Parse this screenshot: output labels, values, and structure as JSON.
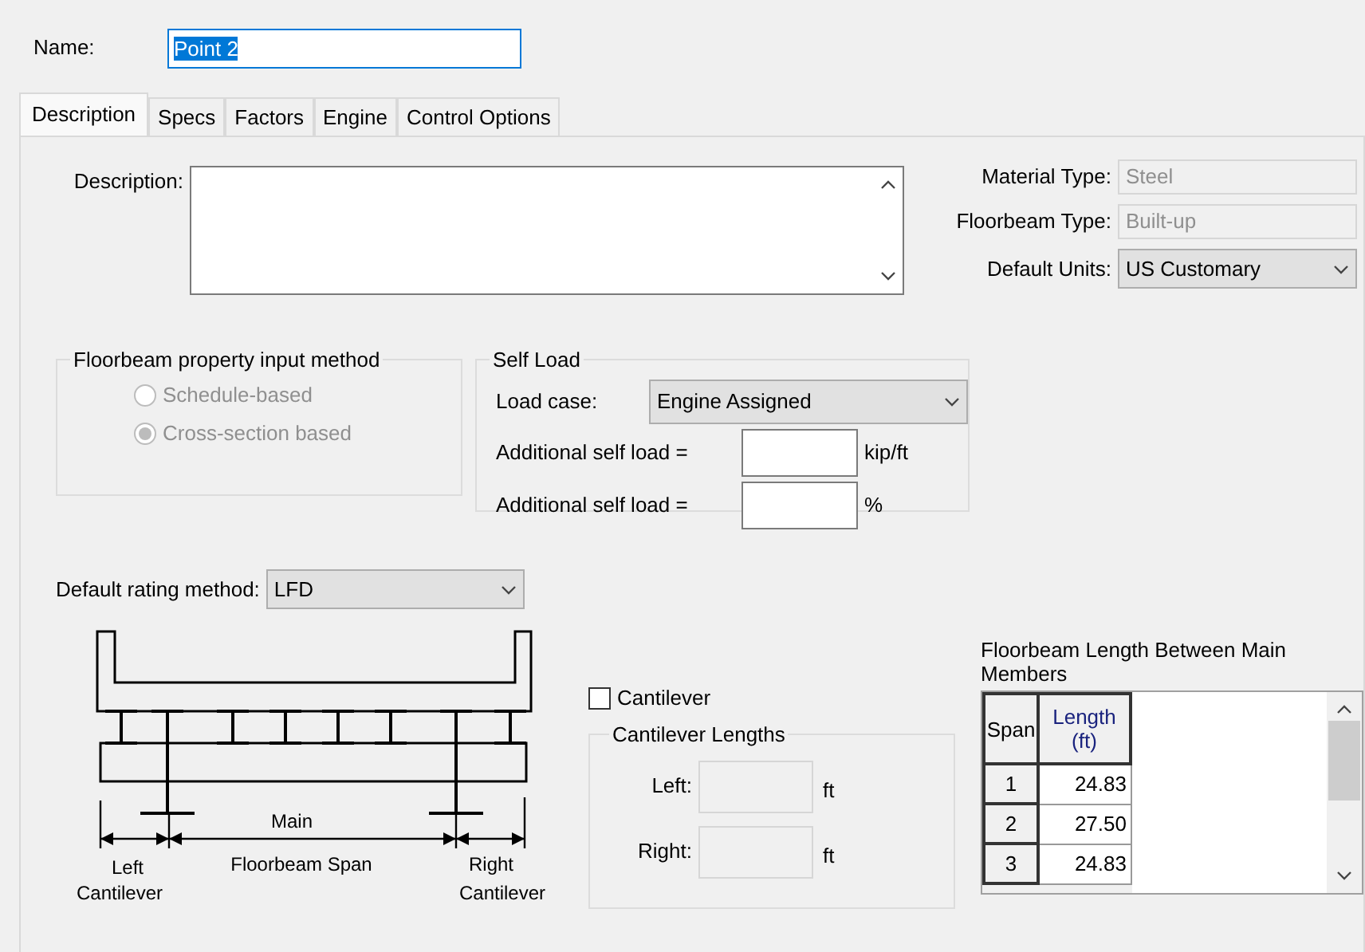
{
  "name_field": {
    "label": "Name:",
    "value": "Point 2"
  },
  "tabs": [
    {
      "label": "Description",
      "selected": true
    },
    {
      "label": "Specs",
      "selected": false
    },
    {
      "label": "Factors",
      "selected": false
    },
    {
      "label": "Engine",
      "selected": false
    },
    {
      "label": "Control Options",
      "selected": false
    }
  ],
  "description": {
    "label": "Description:"
  },
  "properties": [
    {
      "label": "Material Type:",
      "value": "Steel",
      "disabled": true,
      "kind": "text"
    },
    {
      "label": "Floorbeam Type:",
      "value": "Built-up",
      "disabled": true,
      "kind": "text"
    },
    {
      "label": "Default Units:",
      "value": "US Customary",
      "disabled": false,
      "kind": "select"
    }
  ],
  "input_method": {
    "title": "Floorbeam property input method",
    "options": [
      {
        "label": "Schedule-based",
        "selected": false,
        "disabled": true
      },
      {
        "label": "Cross-section based",
        "selected": true,
        "disabled": true
      }
    ]
  },
  "self_load": {
    "title": "Self Load",
    "load_case_label": "Load case:",
    "load_case": "Engine Assigned",
    "rows": [
      {
        "label": "Additional self load =",
        "unit": "kip/ft"
      },
      {
        "label": "Additional self load =",
        "unit": "%"
      }
    ]
  },
  "rating_method": {
    "label": "Default rating method:",
    "value": "LFD"
  },
  "diagram": {
    "main": "Main",
    "span": "Floorbeam Span",
    "left": [
      "Left",
      "Cantilever"
    ],
    "right": [
      "Right",
      "Cantilever"
    ]
  },
  "cantilever": {
    "label": "Cantilever",
    "checked": false,
    "group_title": "Cantilever Lengths",
    "rows": [
      {
        "label": "Left:",
        "unit": "ft"
      },
      {
        "label": "Right:",
        "unit": "ft"
      }
    ]
  },
  "lengths_table": {
    "title": "Floorbeam Length Between Main Members",
    "columns": [
      "Span",
      "Length (ft)"
    ],
    "rows": [
      [
        "1",
        "24.83"
      ],
      [
        "2",
        "27.50"
      ],
      [
        "3",
        "24.83"
      ]
    ]
  }
}
